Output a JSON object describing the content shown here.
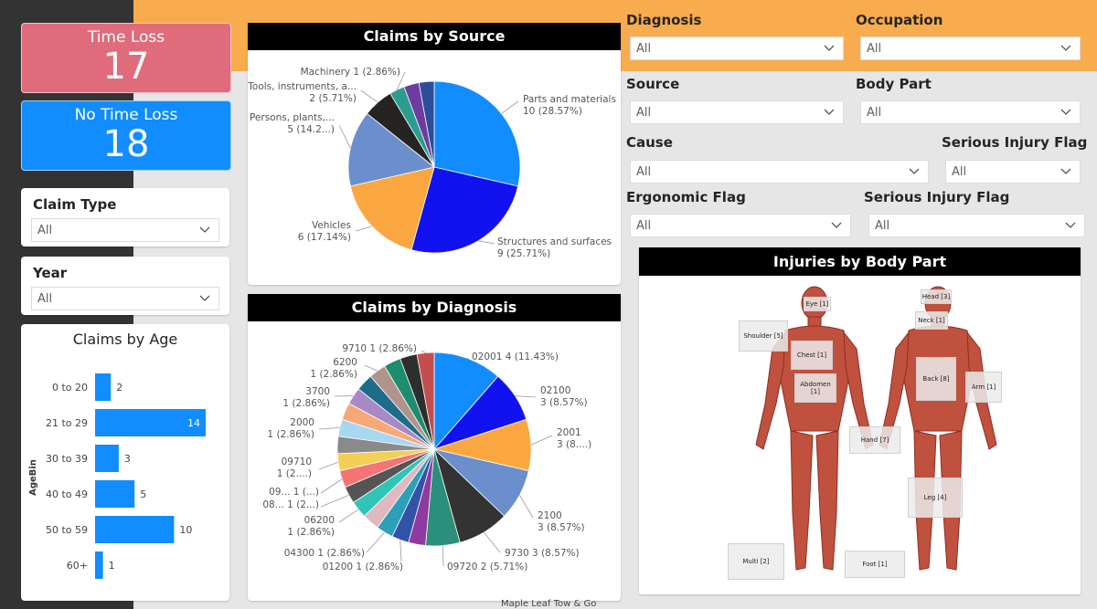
{
  "kpis": {
    "time_loss": {
      "label": "Time Loss",
      "value": "17",
      "color": "#e06b7b"
    },
    "no_time_loss": {
      "label": "No Time Loss",
      "value": "18",
      "color": "#118dff"
    }
  },
  "slicers": {
    "claim_type": {
      "label": "Claim Type",
      "value": "All"
    },
    "year": {
      "label": "Year",
      "value": "All"
    },
    "diagnosis": {
      "label": "Diagnosis",
      "value": "All"
    },
    "occupation": {
      "label": "Occupation",
      "value": "All"
    },
    "source": {
      "label": "Source",
      "value": "All"
    },
    "body_part": {
      "label": "Body Part",
      "value": "All"
    },
    "cause": {
      "label": "Cause",
      "value": "All"
    },
    "serious_injury_flag_1": {
      "label": "Serious Injury Flag",
      "value": "All"
    },
    "ergonomic_flag": {
      "label": "Ergonomic Flag",
      "value": "All"
    },
    "serious_injury_flag_2": {
      "label": "Serious Injury Flag",
      "value": "All"
    }
  },
  "footer": "Maple Leaf Tow & Go",
  "body_part_panel": {
    "title": "Injuries by Body Part",
    "tags": {
      "eye": "Eye [1]",
      "head": "Head [3]",
      "neck": "Neck [1]",
      "shoulder": "Shoulder [5]",
      "chest": "Chest [1]",
      "back": "Back [8]",
      "arm": "Arm [1]",
      "abdomen": "Abdomen [1]",
      "hand": "Hand [7]",
      "leg": "Leg [4]",
      "multi": "Multi [2]",
      "foot": "Foot [1]"
    }
  },
  "chart_data": [
    {
      "type": "pie",
      "title": "Claims by Source",
      "slices": [
        {
          "label": "Parts and materials",
          "value": 10,
          "text": "10 (28.57%)",
          "color": "#118dff"
        },
        {
          "label": "Structures and surfaces",
          "value": 9,
          "text": "9 (25.71%)",
          "color": "#1212f0"
        },
        {
          "label": "Vehicles",
          "value": 6,
          "text": "6 (17.14%)",
          "color": "#fba741"
        },
        {
          "label": "Persons, plants,...",
          "value": 5,
          "text": "5 (14.2...)",
          "color": "#6b8fcc"
        },
        {
          "label": "Tools, instruments, a...",
          "value": 2,
          "text": "2 (5.71%)",
          "color": "#252423"
        },
        {
          "label": "Machinery",
          "value": 1,
          "text": "1 (2.86%)",
          "color": "#2a9d8f"
        },
        {
          "label": "",
          "value": 1,
          "color": "#6e3ca0"
        },
        {
          "label": "",
          "value": 1,
          "color": "#2c4d9a"
        }
      ]
    },
    {
      "type": "pie",
      "title": "Claims by Diagnosis",
      "slices": [
        {
          "label": "02001",
          "value": 4,
          "text": "4 (11.43%)",
          "color": "#118dff"
        },
        {
          "label": "02100",
          "value": 3,
          "text": "3 (8.57%)",
          "color": "#1212f0"
        },
        {
          "label": "2001",
          "value": 3,
          "text": "3 (8....)",
          "color": "#fba741"
        },
        {
          "label": "2100",
          "value": 3,
          "text": "3 (8.57%)",
          "color": "#6b8fcc"
        },
        {
          "label": "9730",
          "value": 3,
          "text": "3 (8.57%)",
          "color": "#333333"
        },
        {
          "label": "09720",
          "value": 2,
          "text": "2 (5.71%)",
          "color": "#2b8f7b"
        },
        {
          "label": "",
          "value": 1,
          "color": "#8f3aa0"
        },
        {
          "label": "01200",
          "value": 1,
          "text": "1 (2.86%)",
          "color": "#3353a8"
        },
        {
          "label": "04300",
          "value": 1,
          "text": "1 (2.86%)",
          "color": "#2ba0b8"
        },
        {
          "label": "",
          "value": 1,
          "color": "#e0b8c0"
        },
        {
          "label": "06200",
          "value": 1,
          "text": "1 (2.86%)",
          "color": "#2ec4b6"
        },
        {
          "label": "08...",
          "value": 1,
          "text": "1 (2...)",
          "color": "#555555"
        },
        {
          "label": "09...",
          "value": 1,
          "text": "1 (...)",
          "color": "#f57575"
        },
        {
          "label": "09710",
          "value": 1,
          "text": "1 (2....)",
          "color": "#f2d055"
        },
        {
          "label": "",
          "value": 1,
          "color": "#8a8a8a"
        },
        {
          "label": "2000",
          "value": 1,
          "text": "1 (2.86%)",
          "color": "#a8d8f0"
        },
        {
          "label": "",
          "value": 1,
          "color": "#f7a878"
        },
        {
          "label": "3700",
          "value": 1,
          "text": "1 (2.86%)",
          "color": "#a889c6"
        },
        {
          "label": "",
          "value": 1,
          "color": "#1f6b8a"
        },
        {
          "label": "6200",
          "value": 1,
          "text": "1 (2.86%)",
          "color": "#b0948c"
        },
        {
          "label": "",
          "value": 1,
          "color": "#1e8c6e"
        },
        {
          "label": "",
          "value": 1,
          "color": "#2e2e2e"
        },
        {
          "label": "9710",
          "value": 1,
          "text": "1 (2.86%)",
          "color": "#c44e4e"
        }
      ]
    },
    {
      "type": "bar",
      "orientation": "horizontal",
      "title": "Claims by Age",
      "ylabel": "AgeBin",
      "categories": [
        "0 to 20",
        "21 to 29",
        "30 to 39",
        "40 to 49",
        "50 to 59",
        "60+"
      ],
      "values": [
        2,
        14,
        3,
        5,
        10,
        1
      ],
      "color": "#118dff",
      "xlim": [
        0,
        14
      ]
    }
  ]
}
